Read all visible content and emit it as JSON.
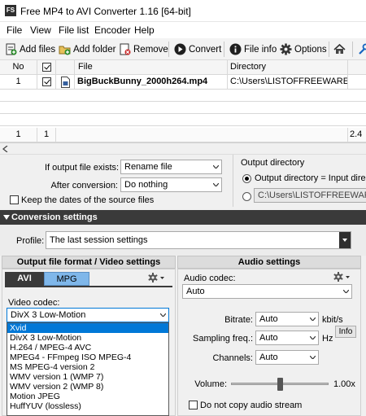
{
  "window": {
    "title": "Free MP4 to AVI Converter 1.16  [64-bit]",
    "icon_text": "FS"
  },
  "menu": [
    "File",
    "View",
    "File list",
    "Encoder",
    "Help"
  ],
  "toolbar": {
    "add_files": "Add files",
    "add_folder": "Add folder",
    "remove": "Remove",
    "convert": "Convert",
    "file_info": "File info",
    "options": "Options"
  },
  "grid": {
    "headers": {
      "no": "No",
      "file": "File",
      "directory": "Directory"
    },
    "rows": [
      {
        "no": "1",
        "checked": true,
        "file": "BigBuckBunny_2000h264.mp4",
        "directory": "C:\\Users\\LISTOFFREEWARE\\Doc..."
      }
    ],
    "footer": {
      "count": "1",
      "checked_count": "1",
      "size": "2.4"
    },
    "size_header_partial": "",
    "size_partial": "2.4"
  },
  "options": {
    "if_exists_label": "If output file exists:",
    "if_exists_value": "Rename file",
    "after_conversion_label": "After conversion:",
    "after_conversion_value": "Do nothing",
    "keep_dates_label": "Keep the dates of the source files",
    "output_dir_title": "Output directory",
    "output_dir_input_label": "Output directory = Input directory",
    "output_dir_path": "C:\\Users\\LISTOFFREEWARE\\Desktop"
  },
  "conversion": {
    "header": "Conversion settings",
    "profile_label": "Profile:",
    "profile_value": "The last session settings",
    "format_header": "Output file format / Video settings",
    "audio_header": "Audio settings",
    "tab_avi": "AVI",
    "tab_mpg": "MPG",
    "video_codec_label": "Video codec:",
    "video_codec_value": "DivX 3 Low-Motion",
    "video_codec_options": [
      "Xvid",
      "DivX 3 Low-Motion",
      "H.264 / MPEG-4 AVC",
      "MPEG4 - FFmpeg ISO MPEG-4",
      "MS MPEG-4 version 2",
      "WMV version 1 (WMP 7)",
      "WMV version 2 (WMP 8)",
      "Motion JPEG",
      "HuffYUV (lossless)"
    ],
    "selected_option": "Xvid",
    "audio_codec_label": "Audio codec:",
    "audio_codec_value": "Auto",
    "bitrate_label": "Bitrate:",
    "bitrate_value": "Auto",
    "bitrate_unit": "kbit/s",
    "sampling_label": "Sampling freq.:",
    "sampling_value": "Auto",
    "sampling_unit": "Hz",
    "info_button": "Info",
    "channels_label": "Channels:",
    "channels_value": "Auto",
    "volume_label": "Volume:",
    "volume_value": "1.00x",
    "volume_level": 0.5,
    "no_copy_audio_label": "Do not copy audio stream"
  },
  "colors": {
    "selection": "#0078d7",
    "header_dark": "#3a3a3a",
    "tab_mpg": "#7fb7ea"
  }
}
